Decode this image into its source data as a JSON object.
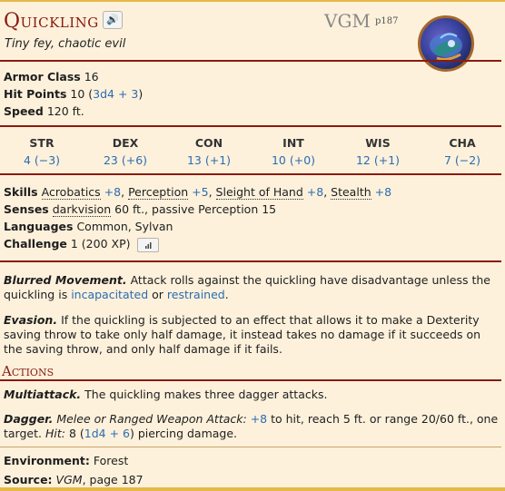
{
  "header": {
    "name": "Quickling",
    "sound_icon": "speaker-icon",
    "source_abbr": "VGM",
    "source_page": "p187",
    "type_line": "Tiny fey, chaotic evil"
  },
  "stats": {
    "ac_label": "Armor Class",
    "ac_value": "16",
    "hp_label": "Hit Points",
    "hp_value_pre": "10 (",
    "hp_dice": "3d4 + 3",
    "hp_value_post": ")",
    "speed_label": "Speed",
    "speed_value": "120 ft."
  },
  "abilities": [
    {
      "name": "STR",
      "value": "4 (−3)"
    },
    {
      "name": "DEX",
      "value": "23 (+6)"
    },
    {
      "name": "CON",
      "value": "13 (+1)"
    },
    {
      "name": "INT",
      "value": "10 (+0)"
    },
    {
      "name": "WIS",
      "value": "12 (+1)"
    },
    {
      "name": "CHA",
      "value": "7 (−2)"
    }
  ],
  "traits": {
    "skills_label": "Skills",
    "skills": [
      {
        "name": "Acrobatics",
        "bonus": "+8"
      },
      {
        "name": "Perception",
        "bonus": "+5"
      },
      {
        "name": "Sleight of Hand",
        "bonus": "+8"
      },
      {
        "name": "Stealth",
        "bonus": "+8"
      }
    ],
    "senses_label": "Senses",
    "senses_sense": "darkvision",
    "senses_rest": "60 ft., passive Perception 15",
    "languages_label": "Languages",
    "languages_value": "Common, Sylvan",
    "challenge_label": "Challenge",
    "challenge_value": "1 (200 XP)",
    "challenge_icon": "bar-chart-icon"
  },
  "features": {
    "blurred_name": "Blurred Movement.",
    "blurred_text_1": "Attack rolls against the quickling have disadvantage unless the quickling is",
    "blurred_link_1": "incapacitated",
    "blurred_text_2": "or",
    "blurred_link_2": "restrained",
    "blurred_text_3": ".",
    "evasion_name": "Evasion.",
    "evasion_text": "If the quickling is subjected to an effect that allows it to make a Dexterity saving throw to take only half damage, it instead takes no damage if it succeeds on the saving throw, and only half damage if it fails."
  },
  "actions": {
    "header": "Actions",
    "multi_name": "Multiattack.",
    "multi_text": "The quickling makes three dagger attacks.",
    "dagger_name": "Dagger.",
    "dagger_attack_type": "Melee or Ranged Weapon Attack:",
    "dagger_bonus": "+8",
    "dagger_text_1": "to hit, reach 5 ft. or range 20/60 ft., one target.",
    "dagger_hit_label": "Hit:",
    "dagger_hit_pre": "8 (",
    "dagger_hit_dice": "1d4 + 6",
    "dagger_hit_post": ") piercing damage."
  },
  "footer": {
    "env_label": "Environment:",
    "env_value": "Forest",
    "source_label": "Source:",
    "source_book": "VGM",
    "source_rest": ", page 187"
  }
}
